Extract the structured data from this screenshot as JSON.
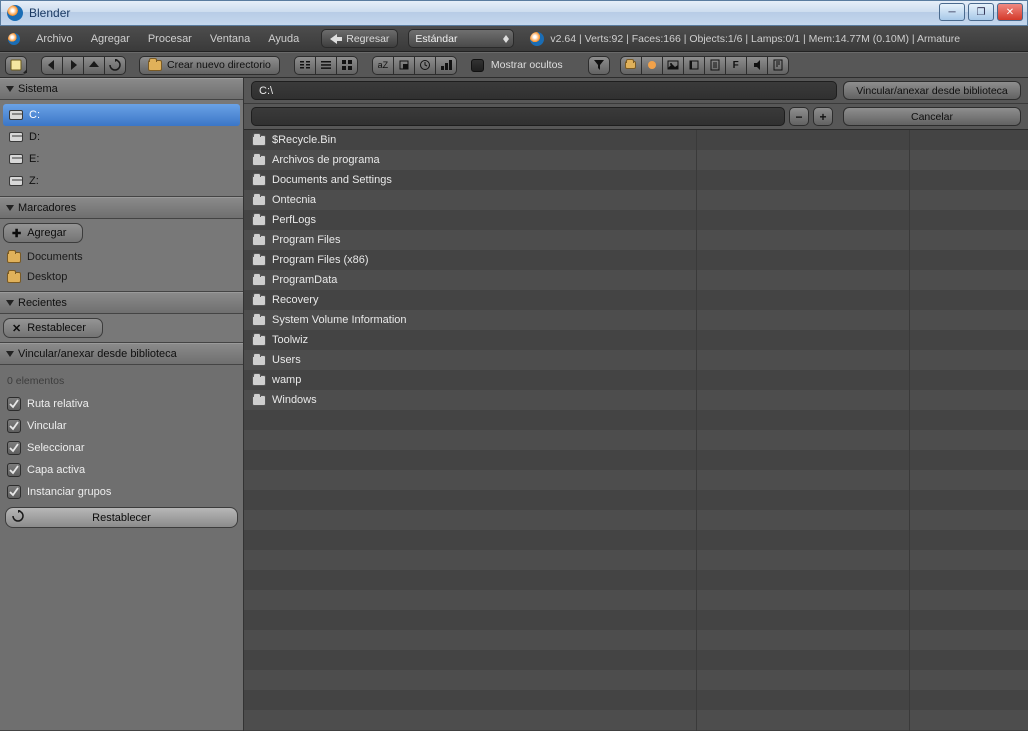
{
  "titlebar": {
    "title": "Blender"
  },
  "menu": {
    "file": "Archivo",
    "add": "Agregar",
    "process": "Procesar",
    "window": "Ventana",
    "help": "Ayuda",
    "back": "Regresar",
    "layout": "Estándar"
  },
  "info": "v2.64 | Verts:92 | Faces:166 | Objects:1/6 | Lamps:0/1 | Mem:14.77M (0.10M) | Armature",
  "toolbar": {
    "newdir": "Crear nuevo directorio",
    "showhidden": "Mostrar ocultos"
  },
  "pathbar": {
    "path": "C:\\",
    "filename": "",
    "open_label": "Vincular/anexar desde biblioteca",
    "cancel_label": "Cancelar"
  },
  "sidebar": {
    "system_label": "Sistema",
    "drives": [
      "C:",
      "D:",
      "E:",
      "Z:"
    ],
    "bookmarks_label": "Marcadores",
    "add_label": "Agregar",
    "bookmarks": [
      "Documents",
      "Desktop"
    ],
    "recent_label": "Recientes",
    "reset_label": "Restablecer",
    "link_label": "Vincular/anexar desde biblioteca",
    "elements": "0 elementos",
    "opts": {
      "relpath": "Ruta relativa",
      "link": "Vincular",
      "select": "Seleccionar",
      "active": "Capa activa",
      "instance": "Instanciar grupos"
    },
    "reset2": "Restablecer"
  },
  "files": [
    "$Recycle.Bin",
    "Archivos de programa",
    "Documents and Settings",
    "Ontecnia",
    "PerfLogs",
    "Program Files",
    "Program Files (x86)",
    "ProgramData",
    "Recovery",
    "System Volume Information",
    "Toolwiz",
    "Users",
    "wamp",
    "Windows"
  ]
}
